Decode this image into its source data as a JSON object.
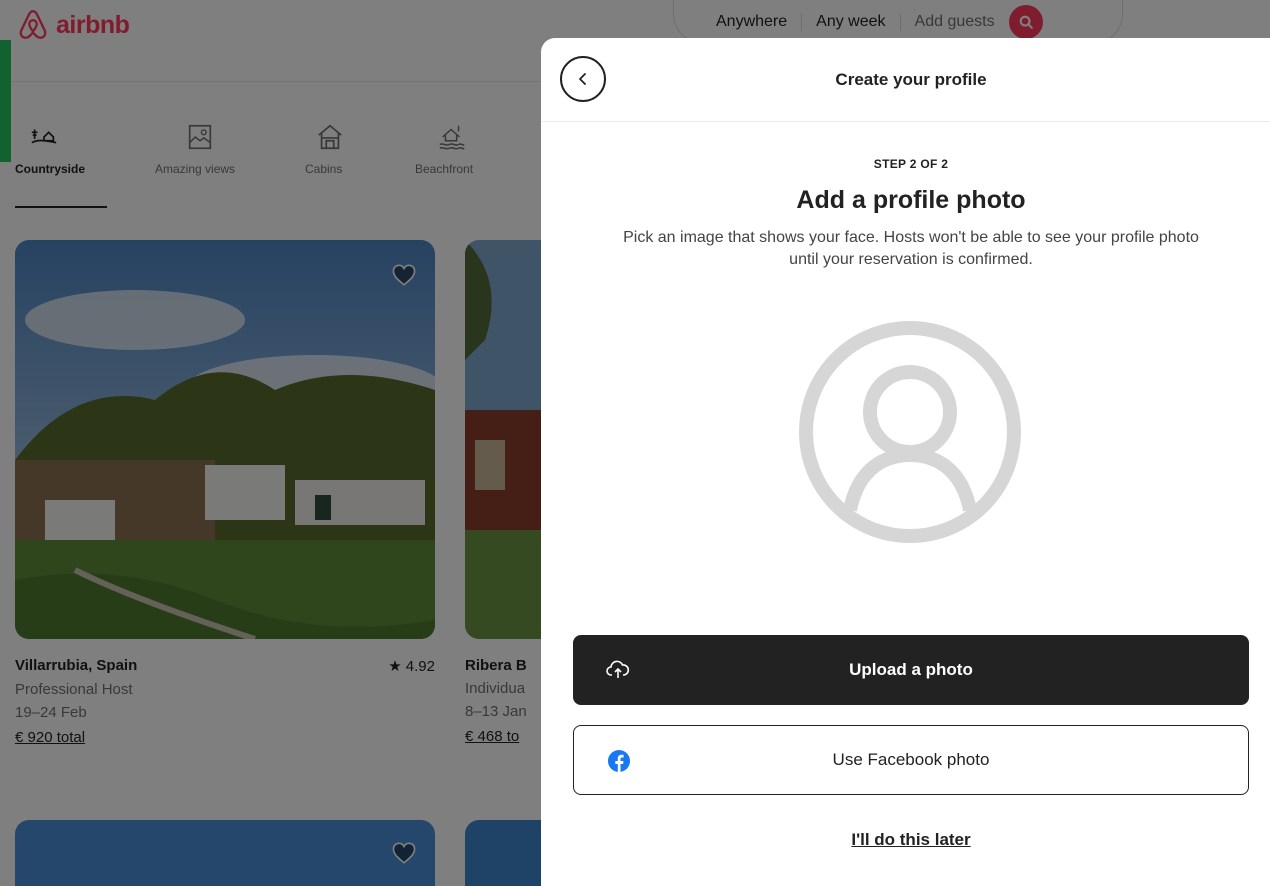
{
  "brand": {
    "name": "airbnb",
    "color": "#ff385c"
  },
  "search": {
    "where": "Anywhere",
    "when": "Any week",
    "guests": "Add guests"
  },
  "categories": [
    {
      "label": "Countryside",
      "icon": "countryside-icon"
    },
    {
      "label": "Amazing views",
      "icon": "amazing-views-icon"
    },
    {
      "label": "Cabins",
      "icon": "cabin-icon"
    },
    {
      "label": "Beachfront",
      "icon": "beachfront-icon"
    }
  ],
  "listings": [
    {
      "location": "Villarrubia, Spain",
      "rating": "★ 4.92",
      "host": "Professional Host",
      "dates": "19–24 Feb",
      "price": "€ 920 total"
    },
    {
      "location": "Ribera B",
      "host": "Individua",
      "dates": "8–13 Jan",
      "price": "€ 468 to"
    }
  ],
  "modal": {
    "title": "Create your profile",
    "step": "STEP 2 OF 2",
    "heading": "Add a profile photo",
    "description": "Pick an image that shows your face. Hosts won't be able to see your profile photo until your reservation is confirmed.",
    "upload_label": "Upload a photo",
    "facebook_label": "Use Facebook photo",
    "later_label": "I'll do this later"
  }
}
